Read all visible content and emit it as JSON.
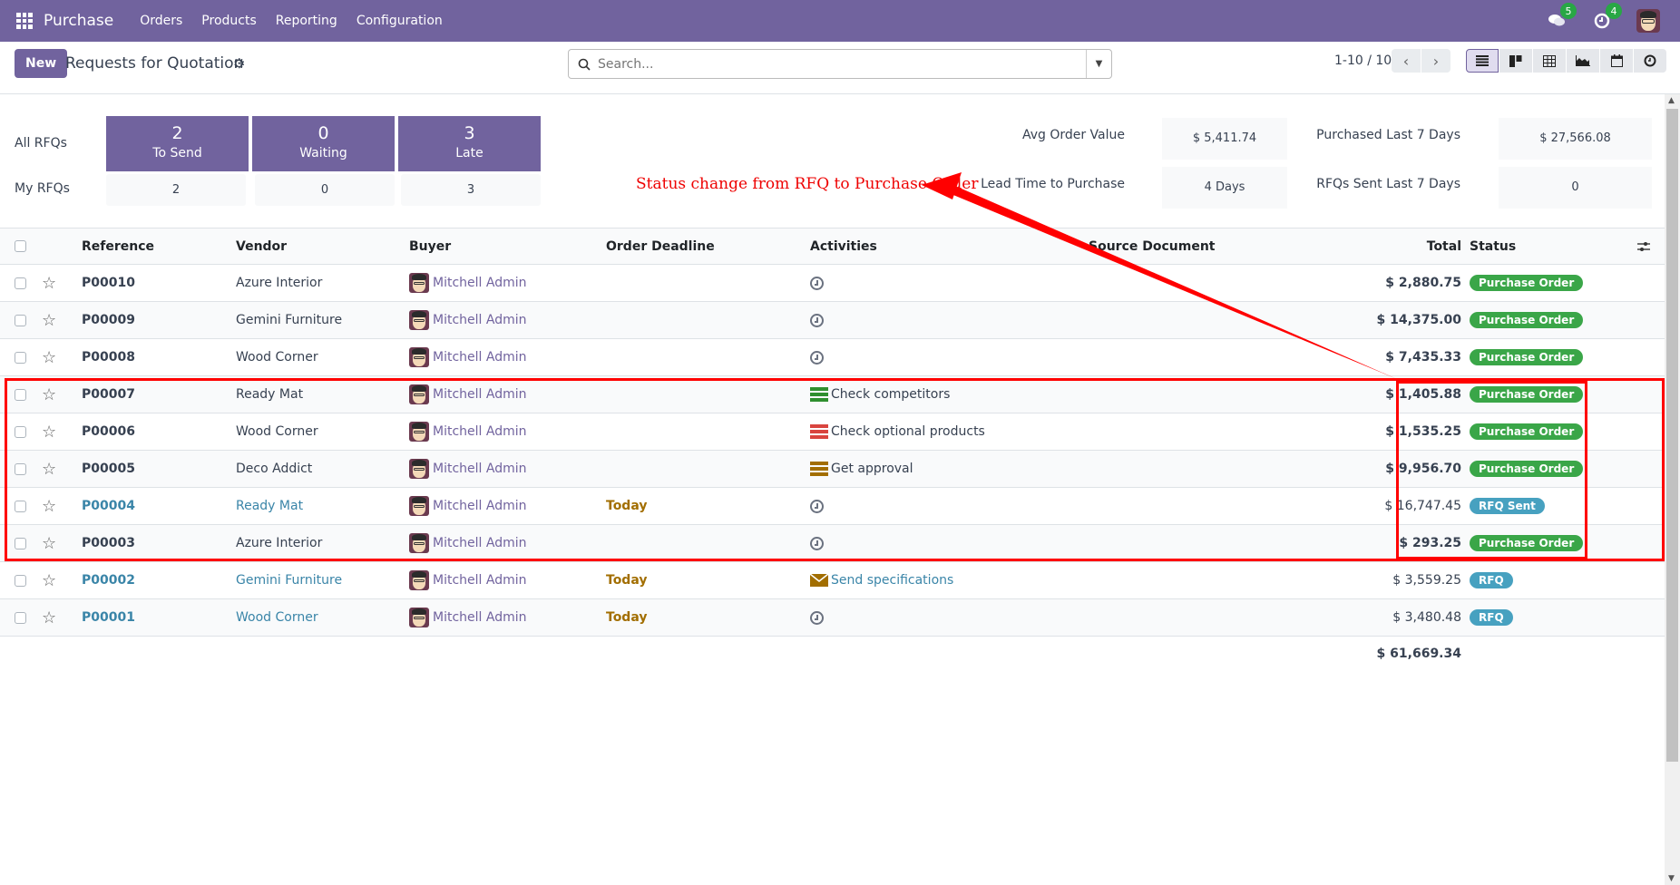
{
  "navbar": {
    "app_name": "Purchase",
    "menu": [
      "Orders",
      "Products",
      "Reporting",
      "Configuration"
    ],
    "messages_count": "5",
    "activities_count": "4"
  },
  "control_panel": {
    "new_label": "New",
    "title": "Requests for Quotation",
    "search_placeholder": "Search...",
    "pager": "1-10 / 10",
    "views": [
      "list",
      "kanban",
      "pivot",
      "graph",
      "calendar",
      "activity"
    ]
  },
  "dashboard": {
    "all_rfqs_label": "All RFQs",
    "my_rfqs_label": "My RFQs",
    "tiles": [
      {
        "value": "2",
        "label": "To Send",
        "mine": "2"
      },
      {
        "value": "0",
        "label": "Waiting",
        "mine": "0"
      },
      {
        "value": "3",
        "label": "Late",
        "mine": "3"
      }
    ],
    "kpis": [
      {
        "label": "Avg Order Value",
        "value": "$ 5,411.74"
      },
      {
        "label": "Purchased Last 7 Days",
        "value": "$ 27,566.08"
      },
      {
        "label": "Lead Time to Purchase",
        "value": "4 Days"
      },
      {
        "label": "RFQs Sent Last 7 Days",
        "value": "0"
      }
    ]
  },
  "annotation": {
    "text": "Status change from RFQ to Purchase Order",
    "color": "#ff0000"
  },
  "table": {
    "columns": [
      "Reference",
      "Vendor",
      "Buyer",
      "Order Deadline",
      "Activities",
      "Source Document",
      "Total",
      "Status"
    ],
    "rows": [
      {
        "ref": "P00010",
        "vendor": "Azure Interior",
        "buyer": "Mitchell Admin",
        "deadline": "",
        "activity": "",
        "activity_type": "clock",
        "source": "",
        "total": "$ 2,880.75",
        "status": "Purchase Order"
      },
      {
        "ref": "P00009",
        "vendor": "Gemini Furniture",
        "buyer": "Mitchell Admin",
        "deadline": "",
        "activity": "",
        "activity_type": "clock",
        "source": "",
        "total": "$ 14,375.00",
        "status": "Purchase Order"
      },
      {
        "ref": "P00008",
        "vendor": "Wood Corner",
        "buyer": "Mitchell Admin",
        "deadline": "",
        "activity": "",
        "activity_type": "clock",
        "source": "",
        "total": "$ 7,435.33",
        "status": "Purchase Order"
      },
      {
        "ref": "P00007",
        "vendor": "Ready Mat",
        "buyer": "Mitchell Admin",
        "deadline": "",
        "activity": "Check competitors",
        "activity_type": "todo-green",
        "source": "",
        "total": "$ 1,405.88",
        "status": "Purchase Order"
      },
      {
        "ref": "P00006",
        "vendor": "Wood Corner",
        "buyer": "Mitchell Admin",
        "deadline": "",
        "activity": "Check optional products",
        "activity_type": "todo-red",
        "source": "",
        "total": "$ 1,535.25",
        "status": "Purchase Order"
      },
      {
        "ref": "P00005",
        "vendor": "Deco Addict",
        "buyer": "Mitchell Admin",
        "deadline": "",
        "activity": "Get approval",
        "activity_type": "todo-amber",
        "source": "",
        "total": "$ 9,956.70",
        "status": "Purchase Order"
      },
      {
        "ref": "P00004",
        "vendor": "Ready Mat",
        "buyer": "Mitchell Admin",
        "deadline": "Today",
        "activity": "",
        "activity_type": "clock",
        "source": "",
        "total": "$ 16,747.45",
        "status": "RFQ Sent"
      },
      {
        "ref": "P00003",
        "vendor": "Azure Interior",
        "buyer": "Mitchell Admin",
        "deadline": "",
        "activity": "",
        "activity_type": "clock",
        "source": "",
        "total": "$ 293.25",
        "status": "Purchase Order"
      },
      {
        "ref": "P00002",
        "vendor": "Gemini Furniture",
        "buyer": "Mitchell Admin",
        "deadline": "Today",
        "activity": "Send specifications",
        "activity_type": "mail",
        "source": "",
        "total": "$ 3,559.25",
        "status": "RFQ"
      },
      {
        "ref": "P00001",
        "vendor": "Wood Corner",
        "buyer": "Mitchell Admin",
        "deadline": "Today",
        "activity": "",
        "activity_type": "clock",
        "source": "",
        "total": "$ 3,480.48",
        "status": "RFQ"
      }
    ],
    "grand_total": "$ 61,669.34"
  },
  "colors": {
    "brand": "#71639e",
    "status_purchase_order": "#3aa648",
    "status_rfq": "#47a1c0",
    "link": "#3a85a8",
    "deadline_today": "#a26e00"
  }
}
